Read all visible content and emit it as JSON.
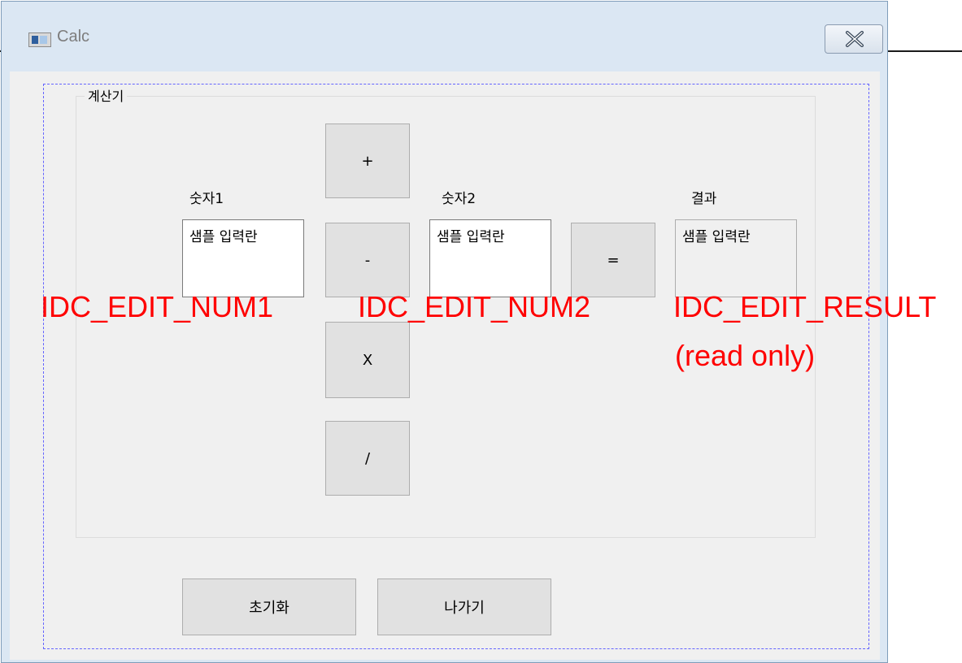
{
  "window": {
    "title": "Calc",
    "icons": {
      "app": "app-icon",
      "close": "close-icon"
    }
  },
  "group": {
    "label": "계산기"
  },
  "labels": {
    "num1": "숫자1",
    "num2": "숫자2",
    "result": "결과"
  },
  "fields": {
    "num1_value": "샘플 입력란",
    "num2_value": "샘플 입력란",
    "result_value": "샘플 입력란"
  },
  "operators": {
    "add": "+",
    "subtract": "-",
    "multiply": "X",
    "divide": "/",
    "equals": "="
  },
  "actions": {
    "reset": "초기화",
    "exit": "나가기"
  },
  "annotations": {
    "num1": "IDC_EDIT_NUM1",
    "num2": "IDC_EDIT_NUM2",
    "result": "IDC_EDIT_RESULT",
    "result_note": "(read only)"
  },
  "colors": {
    "annotation": "#ff0000",
    "guide_border": "#6464ff",
    "button_face": "#e1e1e1"
  }
}
